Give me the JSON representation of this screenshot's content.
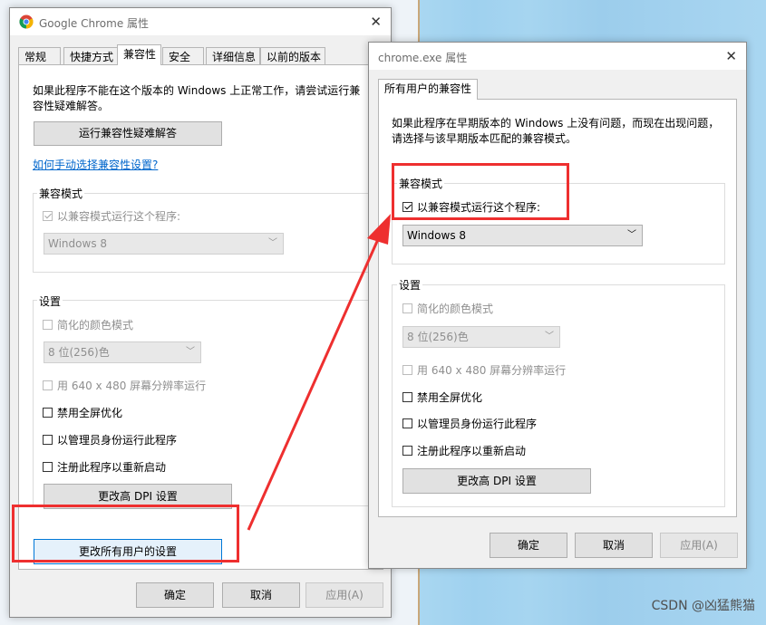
{
  "left_window": {
    "title": "Google Chrome 属性",
    "tabs": [
      "常规",
      "快捷方式",
      "兼容性",
      "安全",
      "详细信息",
      "以前的版本"
    ],
    "intro": "如果此程序不能在这个版本的 Windows 上正常工作，请尝试运行兼容性疑难解答。",
    "troubleshoot_button": "运行兼容性疑难解答",
    "manual_link": "如何手动选择兼容性设置?",
    "compat_group": "兼容模式",
    "compat_checkbox": "以兼容模式运行这个程序:",
    "compat_select": "Windows 8",
    "settings_group": "设置",
    "reduced_color": "简化的颜色模式",
    "color_select": "8 位(256)色",
    "res_640": "用 640 x 480 屏幕分辨率运行",
    "disable_fullscreen": "禁用全屏优化",
    "run_admin": "以管理员身份运行此程序",
    "register_restart": "注册此程序以重新启动",
    "dpi_button": "更改高 DPI 设置",
    "all_users_button": "更改所有用户的设置",
    "ok": "确定",
    "cancel": "取消",
    "apply": "应用(A)"
  },
  "right_window": {
    "title": "chrome.exe 属性",
    "tab": "所有用户的兼容性",
    "intro": "如果此程序在早期版本的 Windows 上没有问题，而现在出现问题，请选择与该早期版本匹配的兼容模式。",
    "compat_group": "兼容模式",
    "compat_checkbox": "以兼容模式运行这个程序:",
    "compat_select": "Windows 8",
    "settings_group": "设置",
    "reduced_color": "简化的颜色模式",
    "color_select": "8 位(256)色",
    "res_640": "用 640 x 480 屏幕分辨率运行",
    "disable_fullscreen": "禁用全屏优化",
    "run_admin": "以管理员身份运行此程序",
    "register_restart": "注册此程序以重新启动",
    "dpi_button": "更改高 DPI 设置",
    "ok": "确定",
    "cancel": "取消",
    "apply": "应用(A)"
  },
  "watermark": "CSDN @凶猛熊猫",
  "colors": {
    "annotation_red": "#ee2f2f",
    "link_blue": "#0066cc"
  }
}
